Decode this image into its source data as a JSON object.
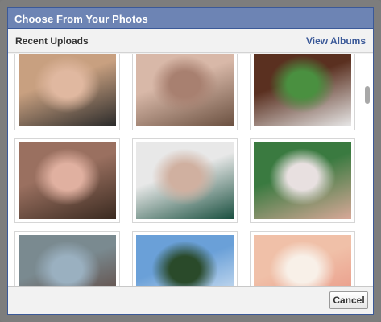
{
  "dialog": {
    "title": "Choose From Your Photos"
  },
  "header": {
    "section_label": "Recent Uploads",
    "view_albums_link": "View Albums"
  },
  "photos": [
    {
      "name": "photo-woman-sunglasses-selfie",
      "colors": [
        "#c8a080",
        "#2a2a2a",
        "#e0b8a0"
      ]
    },
    {
      "name": "photo-baby-sun-hat",
      "colors": [
        "#d8b8a8",
        "#6a5040",
        "#a88070"
      ]
    },
    {
      "name": "photo-man-holding-baby",
      "colors": [
        "#5a3020",
        "#e8e8e8",
        "#4a9040"
      ]
    },
    {
      "name": "photo-man-with-baby-indoors",
      "colors": [
        "#9a7060",
        "#3a2a20",
        "#e0b0a0"
      ]
    },
    {
      "name": "photo-baby-sleeping-green-blanket",
      "colors": [
        "#e8e8e8",
        "#1a5040",
        "#d0b0a0"
      ]
    },
    {
      "name": "photo-woman-with-baby-outdoors",
      "colors": [
        "#3a7a40",
        "#d8a898",
        "#e8e0e0"
      ]
    },
    {
      "name": "photo-man-with-baby-hat-outdoors",
      "colors": [
        "#7a8a90",
        "#5a3a30",
        "#9ab0c0"
      ]
    },
    {
      "name": "photo-man-palm-trees-beach",
      "colors": [
        "#6aa0d8",
        "#e8f0f8",
        "#2a4a2a"
      ]
    },
    {
      "name": "photo-baby-arms-up",
      "colors": [
        "#f0c0a8",
        "#e89080",
        "#f8f0e8"
      ]
    }
  ],
  "footer": {
    "cancel_label": "Cancel"
  }
}
